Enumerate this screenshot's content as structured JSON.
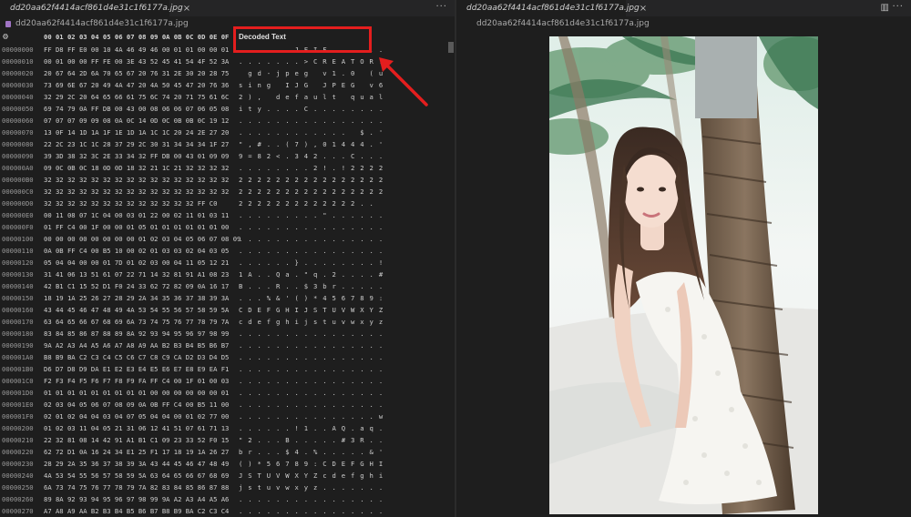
{
  "left_tab": {
    "title": "dd20aa62f4414acf861d4e31c1f6177a.jpg",
    "close": "×",
    "more": "···"
  },
  "left_breadcrumb": "dd20aa62f4414acf861d4e31c1f6177a.jpg",
  "right_tab": {
    "title": "dd20aa62f4414acf861d4e31c1f6177a.jpg",
    "close": "×",
    "split": "▥",
    "more": "···"
  },
  "right_breadcrumb": "dd20aa62f4414acf861d4e31c1f6177a.jpg",
  "hex_header": {
    "columns": "00 01 02 03 04 05 06 07 08 09 0A 0B 0C 0D 0E 0F",
    "decoded_title": "Decoded Text"
  },
  "rows": [
    {
      "offset": "00000000",
      "hex": "FF D8 FF E0 00 10 4A 46 49 46 00 01 01 00 00 01",
      "text": ". . . . . . J F I F . . . . . ."
    },
    {
      "offset": "00000010",
      "hex": "00 01 00 00 FF FE 00 3E 43 52 45 41 54 4F 52 3A",
      "text": ". . . . . . . > C R E A T O R :"
    },
    {
      "offset": "00000020",
      "hex": "20 67 64 2D 6A 70 65 67 20 76 31 2E 30 20 28 75",
      "text": "  g d - j p e g   v 1 . 0   ( u"
    },
    {
      "offset": "00000030",
      "hex": "73 69 6E 67 20 49 4A 47 20 4A 50 45 47 20 76 36",
      "text": "s i n g   I J G   J P E G   v 6"
    },
    {
      "offset": "00000040",
      "hex": "32 29 2C 20 64 65 66 61 75 6C 74 20 71 75 61 6C",
      "text": "2 ) ,   d e f a u l t   q u a l"
    },
    {
      "offset": "00000050",
      "hex": "69 74 79 0A FF DB 00 43 00 08 06 06 07 06 05 08",
      "text": "i t y . . . . C . . . . . . . ."
    },
    {
      "offset": "00000060",
      "hex": "07 07 07 09 09 08 0A 0C 14 0D 0C 0B 0B 0C 19 12",
      "text": ". . . . . . . . . . . . . . . ."
    },
    {
      "offset": "00000070",
      "hex": "13 0F 14 1D 1A 1F 1E 1D 1A 1C 1C 20 24 2E 27 20",
      "text": ". . . . . . . . . . . .   $ . '"
    },
    {
      "offset": "00000080",
      "hex": "22 2C 23 1C 1C 28 37 29 2C 30 31 34 34 34 1F 27",
      "text": "\" , # . . ( 7 ) , 0 1 4 4 4 . '"
    },
    {
      "offset": "00000090",
      "hex": "39 3D 38 32 3C 2E 33 34 32 FF DB 00 43 01 09 09",
      "text": "9 = 8 2 < . 3 4 2 . . . C . . ."
    },
    {
      "offset": "000000A0",
      "hex": "09 0C 0B 0C 18 0D 0D 18 32 21 1C 21 32 32 32 32",
      "text": ". . . . . . . . 2 ! . ! 2 2 2 2"
    },
    {
      "offset": "000000B0",
      "hex": "32 32 32 32 32 32 32 32 32 32 32 32 32 32 32 32",
      "text": "2 2 2 2 2 2 2 2 2 2 2 2 2 2 2 2"
    },
    {
      "offset": "000000C0",
      "hex": "32 32 32 32 32 32 32 32 32 32 32 32 32 32 32 32",
      "text": "2 2 2 2 2 2 2 2 2 2 2 2 2 2 2 2"
    },
    {
      "offset": "000000D0",
      "hex": "32 32 32 32 32 32 32 32 32 32 32 32 32 FF C0",
      "text": "2 2 2 2 2 2 2 2 2 2 2 2 2 . ."
    },
    {
      "offset": "000000E0",
      "hex": "00 11 08 07 1C 04 00 03 01 22 00 02 11 01 03 11",
      "text": ". . . . . . . . . \" . . . . . ."
    },
    {
      "offset": "000000F0",
      "hex": "01 FF C4 00 1F 00 00 01 05 01 01 01 01 01 01 00",
      "text": ". . . . . . . . . . . . . . . ."
    },
    {
      "offset": "00000100",
      "hex": "00 00 00 00 00 00 00 00 01 02 03 04 05 06 07 08 09",
      "text": ". . . . . . . . . . . . . . . ."
    },
    {
      "offset": "00000110",
      "hex": "0A 0B FF C4 00 B5 10 00 02 01 03 03 02 04 03 05",
      "text": ". . . . . . . . . . . . . . . ."
    },
    {
      "offset": "00000120",
      "hex": "05 04 04 00 00 01 7D 01 02 03 00 04 11 05 12 21",
      "text": ". . . . . . } . . . . . . . . !"
    },
    {
      "offset": "00000130",
      "hex": "31 41 06 13 51 61 07 22 71 14 32 81 91 A1 08 23",
      "text": "1 A . . Q a . \" q . 2 . . . . #"
    },
    {
      "offset": "00000140",
      "hex": "42 B1 C1 15 52 D1 F0 24 33 62 72 82 09 0A 16 17",
      "text": "B . . . R . . $ 3 b r . . . . ."
    },
    {
      "offset": "00000150",
      "hex": "18 19 1A 25 26 27 28 29 2A 34 35 36 37 38 39 3A",
      "text": ". . . % & ' ( ) * 4 5 6 7 8 9 :"
    },
    {
      "offset": "00000160",
      "hex": "43 44 45 46 47 48 49 4A 53 54 55 56 57 58 59 5A",
      "text": "C D E F G H I J S T U V W X Y Z"
    },
    {
      "offset": "00000170",
      "hex": "63 64 65 66 67 68 69 6A 73 74 75 76 77 78 79 7A",
      "text": "c d e f g h i j s t u v w x y z"
    },
    {
      "offset": "00000180",
      "hex": "83 84 85 86 87 88 89 8A 92 93 94 95 96 97 98 99",
      "text": ". . . . . . . . . . . . . . . ."
    },
    {
      "offset": "00000190",
      "hex": "9A A2 A3 A4 A5 A6 A7 A8 A9 AA B2 B3 B4 B5 B6 B7",
      "text": ". . . . . . . . . . . . . . . ."
    },
    {
      "offset": "000001A0",
      "hex": "B8 B9 BA C2 C3 C4 C5 C6 C7 C8 C9 CA D2 D3 D4 D5",
      "text": ". . . . . . . . . . . . . . . ."
    },
    {
      "offset": "000001B0",
      "hex": "D6 D7 D8 D9 DA E1 E2 E3 E4 E5 E6 E7 E8 E9 EA F1",
      "text": ". . . . . . . . . . . . . . . ."
    },
    {
      "offset": "000001C0",
      "hex": "F2 F3 F4 F5 F6 F7 F8 F9 FA FF C4 00 1F 01 00 03",
      "text": ". . . . . . . . . . . . . . . ."
    },
    {
      "offset": "000001D0",
      "hex": "01 01 01 01 01 01 01 01 01 00 00 00 00 00 00 01",
      "text": ". . . . . . . . . . . . . . . ."
    },
    {
      "offset": "000001E0",
      "hex": "02 03 04 05 06 07 08 09 0A 0B FF C4 00 B5 11 00",
      "text": ". . . . . . . . . . . . . . . ."
    },
    {
      "offset": "000001F0",
      "hex": "02 01 02 04 04 03 04 07 05 04 04 00 01 02 77 00",
      "text": ". . . . . . . . . . . . . . . w"
    },
    {
      "offset": "00000200",
      "hex": "01 02 03 11 04 05 21 31 06 12 41 51 07 61 71 13",
      "text": ". . . . . . ! 1 . . A Q . a q ."
    },
    {
      "offset": "00000210",
      "hex": "22 32 81 08 14 42 91 A1 B1 C1 09 23 33 52 F0 15",
      "text": "\" 2 . . . B . . . . . # 3 R . ."
    },
    {
      "offset": "00000220",
      "hex": "62 72 D1 0A 16 24 34 E1 25 F1 17 18 19 1A 26 27",
      "text": "b r . . . $ 4 . % . . . . . & '"
    },
    {
      "offset": "00000230",
      "hex": "28 29 2A 35 36 37 38 39 3A 43 44 45 46 47 48 49",
      "text": "( ) * 5 6 7 8 9 : C D E F G H I"
    },
    {
      "offset": "00000240",
      "hex": "4A 53 54 55 56 57 58 59 5A 63 64 65 66 67 68 69",
      "text": "J S T U V W X Y Z c d e f g h i"
    },
    {
      "offset": "00000250",
      "hex": "6A 73 74 75 76 77 78 79 7A 82 83 84 85 86 87 88",
      "text": "j s t u v w x y z . . . . . . ."
    },
    {
      "offset": "00000260",
      "hex": "89 8A 92 93 94 95 96 97 98 99 9A A2 A3 A4 A5 A6",
      "text": ". . . . . . . . . . . . . . . ."
    },
    {
      "offset": "00000270",
      "hex": "A7 A8 A9 AA B2 B3 B4 B5 B6 B7 B8 B9 BA C2 C3 C4",
      "text": ". . . . . . . . . . . . . . . ."
    }
  ],
  "colors": {
    "annotation": "#e41e1e",
    "file_icon": "#a074c4",
    "background": "#1e1e1e"
  },
  "icons": [
    "gear-icon",
    "close-icon",
    "more-icon",
    "split-editor-icon",
    "image-file-icon"
  ]
}
